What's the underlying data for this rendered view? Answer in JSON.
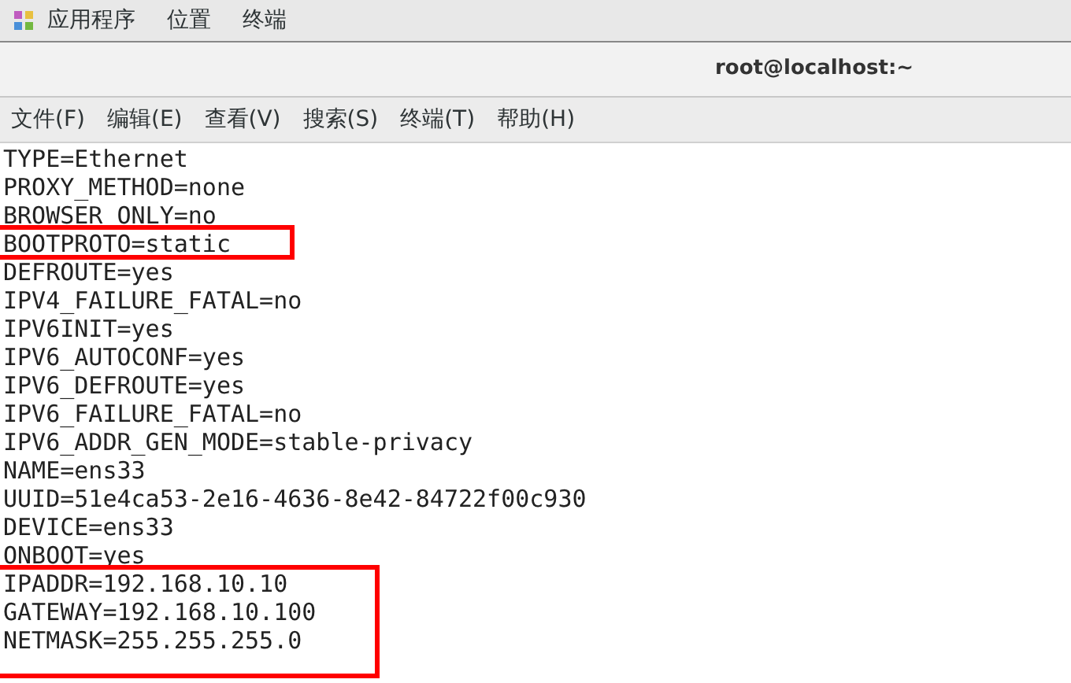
{
  "top_bar": {
    "menus": [
      "应用程序",
      "位置",
      "终端"
    ]
  },
  "window": {
    "title": "root@localhost:~"
  },
  "menu_bar": [
    "文件(F)",
    "编辑(E)",
    "查看(V)",
    "搜索(S)",
    "终端(T)",
    "帮助(H)"
  ],
  "lines": [
    {
      "text": "TYPE=Ethernet",
      "highlighted": false
    },
    {
      "text": "PROXY_METHOD=none",
      "highlighted": false
    },
    {
      "text": "BROWSER_ONLY=no",
      "highlighted": false
    },
    {
      "text": "BOOTPROTO=static",
      "highlighted": true
    },
    {
      "text": "DEFROUTE=yes",
      "highlighted": false
    },
    {
      "text": "IPV4_FAILURE_FATAL=no",
      "highlighted": false
    },
    {
      "text": "IPV6INIT=yes",
      "highlighted": false
    },
    {
      "text": "IPV6_AUTOCONF=yes",
      "highlighted": false
    },
    {
      "text": "IPV6_DEFROUTE=yes",
      "highlighted": false
    },
    {
      "text": "IPV6_FAILURE_FATAL=no",
      "highlighted": false
    },
    {
      "text": "IPV6_ADDR_GEN_MODE=stable-privacy",
      "highlighted": false
    },
    {
      "text": "NAME=ens33",
      "highlighted": false
    },
    {
      "text": "UUID=51e4ca53-2e16-4636-8e42-84722f00c930",
      "highlighted": false
    },
    {
      "text": "DEVICE=ens33",
      "highlighted": false
    },
    {
      "text": "ONBOOT=yes",
      "highlighted": false
    },
    {
      "text": "IPADDR=192.168.10.10",
      "highlighted": true
    },
    {
      "text": "GATEWAY=192.168.10.100",
      "highlighted": true
    },
    {
      "text": "NETMASK=255.255.255.0",
      "highlighted": true
    }
  ]
}
